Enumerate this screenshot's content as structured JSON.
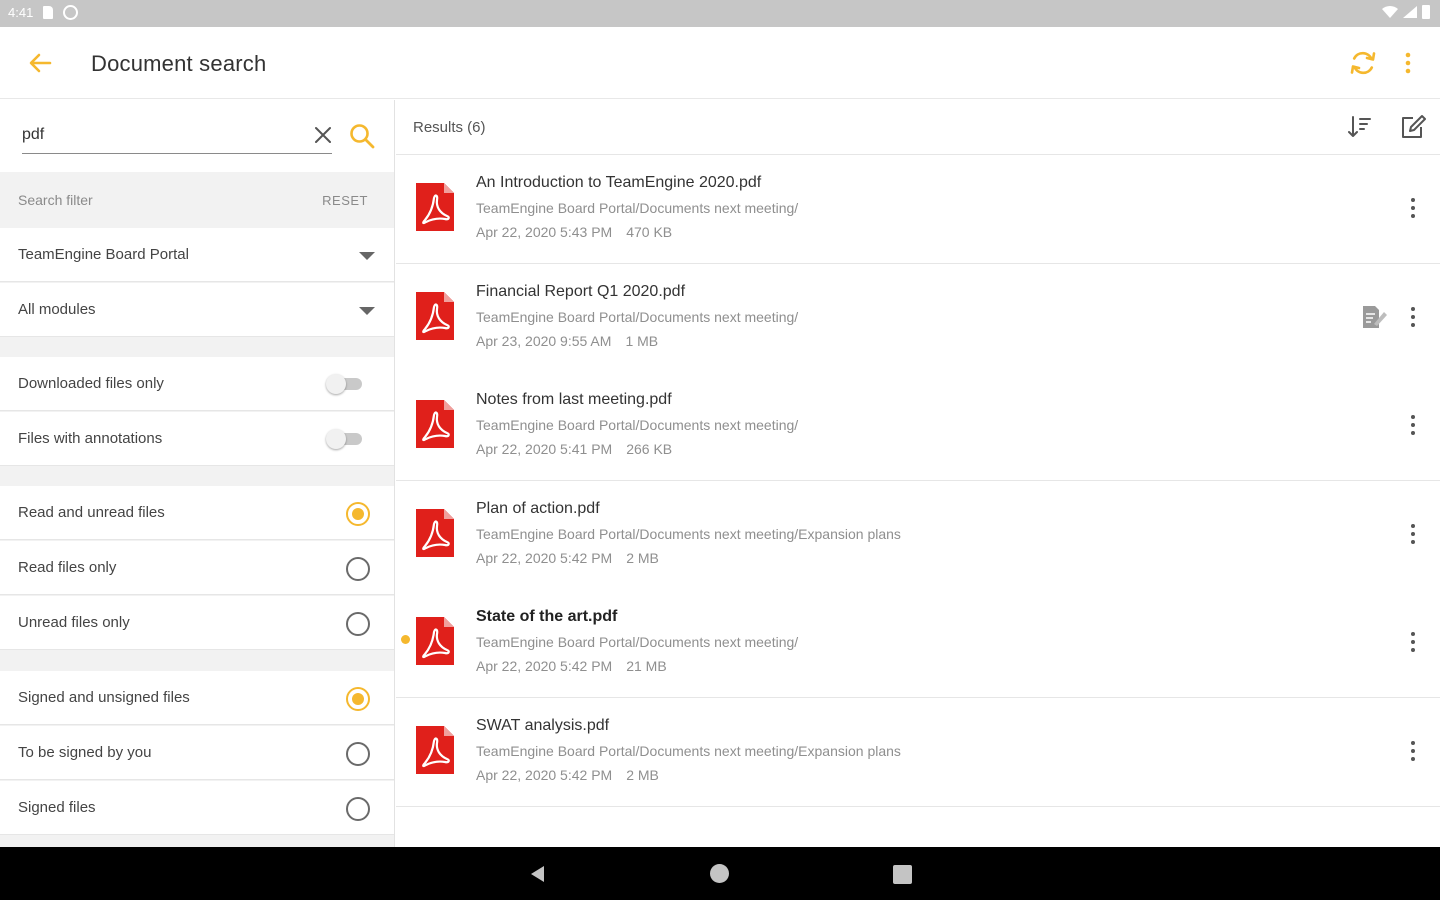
{
  "status_bar": {
    "time": "4:41"
  },
  "app_bar": {
    "title": "Document search"
  },
  "search": {
    "value": "pdf",
    "placeholder": ""
  },
  "filter": {
    "header": "Search filter",
    "reset_label": "RESET",
    "source": "TeamEngine Board Portal",
    "module": "All modules",
    "toggles": [
      {
        "label": "Downloaded files only",
        "on": false
      },
      {
        "label": "Files with annotations",
        "on": false
      }
    ],
    "read_options": [
      {
        "label": "Read and unread files",
        "selected": true
      },
      {
        "label": "Read files only",
        "selected": false
      },
      {
        "label": "Unread files only",
        "selected": false
      }
    ],
    "sign_options": [
      {
        "label": "Signed and unsigned files",
        "selected": true
      },
      {
        "label": "To be signed by you",
        "selected": false
      },
      {
        "label": "Signed files",
        "selected": false
      }
    ]
  },
  "results": {
    "header": "Results (6)",
    "items": [
      {
        "name": "An Introduction to TeamEngine 2020.pdf",
        "path": "TeamEngine Board Portal/Documents next meeting/",
        "date": "Apr 22, 2020 5:43 PM",
        "size": "470 KB",
        "unread": false,
        "signable": false
      },
      {
        "name": "Financial Report Q1 2020.pdf",
        "path": "TeamEngine Board Portal/Documents next meeting/",
        "date": "Apr 23, 2020 9:55 AM",
        "size": "1 MB",
        "unread": false,
        "signable": true
      },
      {
        "name": "Notes from last meeting.pdf",
        "path": "TeamEngine Board Portal/Documents next meeting/",
        "date": "Apr 22, 2020 5:41 PM",
        "size": "266 KB",
        "unread": false,
        "signable": false
      },
      {
        "name": "Plan of action.pdf",
        "path": "TeamEngine Board Portal/Documents next meeting/Expansion plans",
        "date": "Apr 22, 2020 5:42 PM",
        "size": "2 MB",
        "unread": false,
        "signable": false
      },
      {
        "name": "State of the art.pdf",
        "path": "TeamEngine Board Portal/Documents next meeting/",
        "date": "Apr 22, 2020 5:42 PM",
        "size": "21 MB",
        "unread": true,
        "signable": false
      },
      {
        "name": "SWAT analysis.pdf",
        "path": "TeamEngine Board Portal/Documents next meeting/Expansion plans",
        "date": "Apr 22, 2020 5:42 PM",
        "size": "2 MB",
        "unread": false,
        "signable": false
      }
    ]
  },
  "colors": {
    "accent": "#f5b82e",
    "pdf_red": "#e0201b",
    "status_bar": "#c6c6c6"
  },
  "icons": {
    "back": "arrow-left-icon",
    "sync": "sync-icon",
    "overflow": "more-vertical-icon",
    "clear": "close-icon",
    "search": "search-icon",
    "sort": "sort-icon",
    "edit": "edit-icon",
    "file": "pdf-file-icon",
    "sign": "signature-icon"
  }
}
